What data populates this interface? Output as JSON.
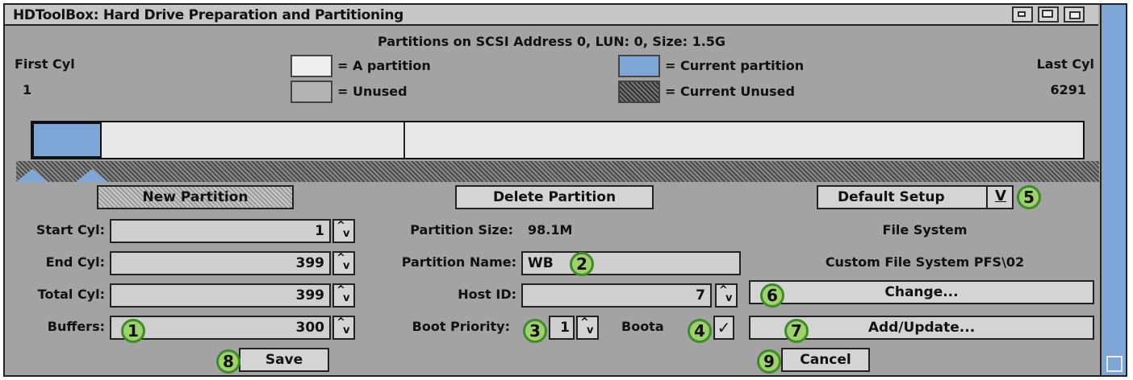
{
  "window": {
    "title": "HDToolBox: Hard Drive Preparation and Partitioning",
    "gadgets": [
      "depth-icon",
      "zoom-icon",
      "resize-icon"
    ]
  },
  "header": {
    "partitions_title": "Partitions on SCSI Address 0, LUN: 0, Size: 1.5G",
    "first_cyl_label": "First Cyl",
    "first_cyl_value": "1",
    "last_cyl_label": "Last Cyl",
    "last_cyl_value": "6291"
  },
  "legend": {
    "a_partition": "= A partition",
    "unused": "= Unused",
    "current_partition": "= Current partition",
    "current_unused": "= Current Unused"
  },
  "colors": {
    "window_bg": "#a3a3a3",
    "current_partition": "#7ea7d8",
    "badge_fill": "#9fd26a",
    "badge_border": "#3f8a2b"
  },
  "buttons": {
    "new_partition": "New Partition",
    "delete_partition": "Delete Partition",
    "default_setup": "Default Setup",
    "default_setup_dropdown": "V",
    "change": "Change...",
    "add_update": "Add/Update...",
    "save": "Save",
    "cancel": "Cancel"
  },
  "fields": {
    "start_cyl_label": "Start Cyl:",
    "start_cyl": "1",
    "end_cyl_label": "End Cyl:",
    "end_cyl": "399",
    "total_cyl_label": "Total Cyl:",
    "total_cyl": "399",
    "buffers_label": "Buffers:",
    "buffers": "300",
    "partition_size_label": "Partition Size:",
    "partition_size": "98.1M",
    "partition_name_label": "Partition Name:",
    "partition_name": "WB",
    "host_id_label": "Host ID:",
    "host_id": "7",
    "boot_priority_label": "Boot Priority:",
    "boot_priority": "1",
    "bootable_label": "Boota",
    "bootable_check": "✓"
  },
  "filesystem": {
    "label": "File System",
    "value": "Custom File System PFS\\02"
  },
  "spinner": {
    "up": "^",
    "down": "v"
  },
  "badges": [
    "1",
    "2",
    "3",
    "4",
    "5",
    "6",
    "7",
    "8",
    "9"
  ]
}
